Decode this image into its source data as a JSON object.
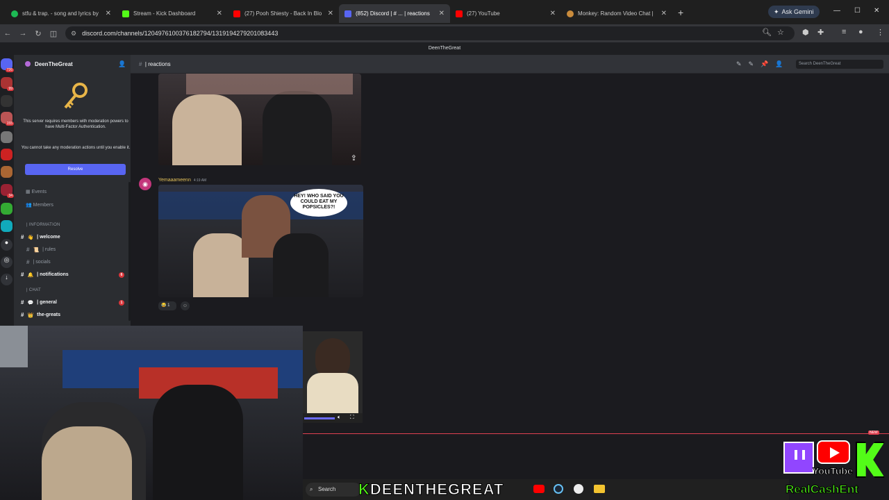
{
  "browser": {
    "tabs": [
      {
        "label": "stfu & trap. - song and lyrics by",
        "color": "#1db954",
        "active": false
      },
      {
        "label": "Stream - Kick Dashboard",
        "color": "#53fc18",
        "active": false
      },
      {
        "label": "(27) Pooh Shiesty - Back In Blo",
        "color": "#ff0000",
        "active": false
      },
      {
        "label": "(852) Discord | # ... | reactions",
        "color": "#5865f2",
        "active": true
      },
      {
        "label": "(27) YouTube",
        "color": "#ff0000",
        "active": false
      },
      {
        "label": "Monkey: Random Video Chat |",
        "color": "#c98b3c",
        "active": false
      }
    ],
    "new_tab": "+",
    "ask_gemini": "Ask Gemini",
    "url": "discord.com/channels/1204976100376182794/1319194279201083443"
  },
  "discord": {
    "window_title": "DeenTheGreat",
    "server_name": "DeenTheGreat",
    "mfa_notice": "This server requires members with moderation powers to have Multi-Factor Authentication.",
    "mfa_warning": "You cannot take any moderation actions until you enable it.",
    "resolve_label": "Resolve",
    "events_label": "Events",
    "members_label": "Members",
    "categories": {
      "information": "| INFORMATION",
      "chat": "| CHAT"
    },
    "channels": [
      {
        "emoji": "👋",
        "name": "| welcome",
        "bold": true,
        "badge": ""
      },
      {
        "emoji": "📜",
        "name": "| rules",
        "bold": false,
        "badge": ""
      },
      {
        "emoji": "",
        "name": "| socials",
        "bold": false,
        "badge": ""
      },
      {
        "emoji": "🔔",
        "name": "| notifications",
        "bold": true,
        "badge": "6"
      },
      {
        "emoji": "💬",
        "name": "| general",
        "bold": true,
        "badge": "1"
      },
      {
        "emoji": "👑",
        "name": "the-greats",
        "bold": true,
        "badge": ""
      }
    ],
    "channel_header": "| reactions",
    "search_placeholder": "Search DeenTheGreat",
    "message": {
      "author": "Yemaaameenn",
      "timestamp": "4:19 AM",
      "speech_bubble": "HEY! WHO SAID YOU COULD EAT MY POPSICLES?!",
      "reaction_count": "1"
    },
    "server_badges": [
      "726",
      "99",
      "155",
      "34"
    ]
  },
  "taskbar": {
    "search_label": "Search",
    "brand": "DEENTHEGREAT",
    "brand_prefix": "K"
  },
  "overlay": {
    "youtube_text": "YouTube",
    "realcash": "RealCashEnt",
    "new_tag": "NEW"
  },
  "colors": {
    "accent": "#5865f2",
    "kick_green": "#53fc18",
    "notification_red": "#da373c"
  }
}
